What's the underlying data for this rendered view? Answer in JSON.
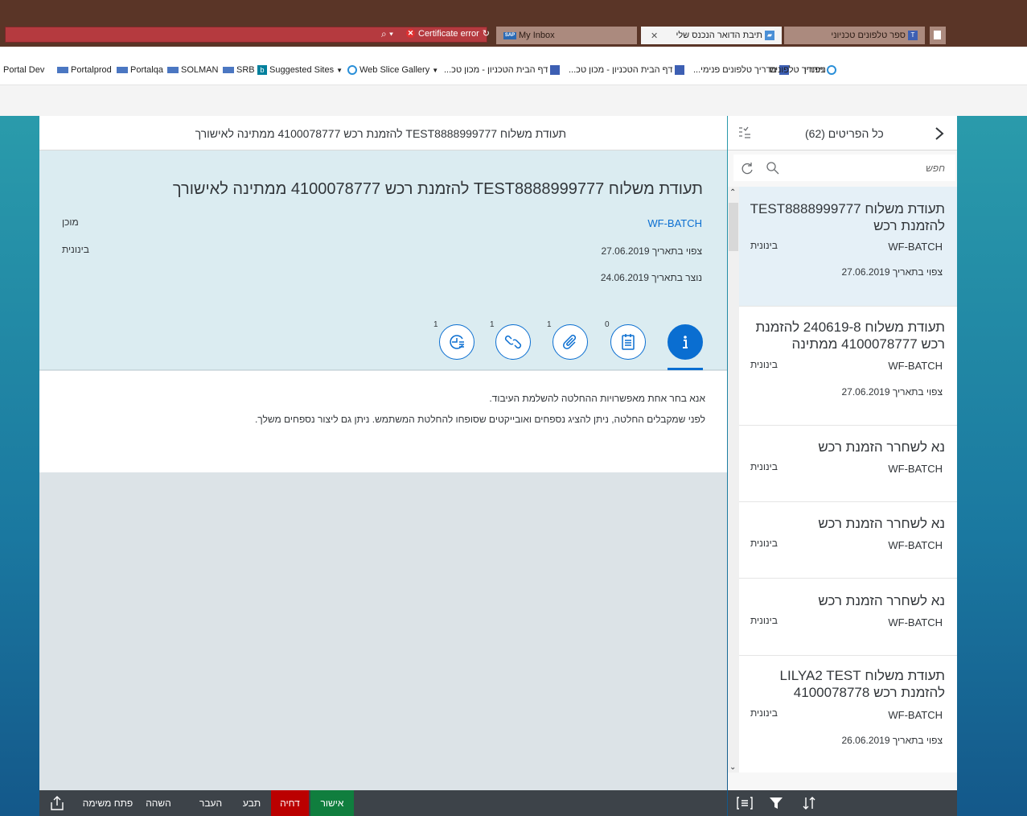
{
  "browser": {
    "tabs": [
      {
        "label": "ספר טלפונים טכניוני"
      },
      {
        "label": "תיבת הדואר הנכנס שלי"
      },
      {
        "label": "My Inbox"
      }
    ],
    "cert_error": "Certificate error",
    "favorites": [
      {
        "label": "Portal Dev"
      },
      {
        "label": "Portalprod"
      },
      {
        "label": "Portalqa"
      },
      {
        "label": "SOLMAN"
      },
      {
        "label": "SRB"
      },
      {
        "label": "Suggested Sites"
      },
      {
        "label": "Web Slice Gallery"
      },
      {
        "label": "דף הבית הטכניון - מכון טכ..."
      },
      {
        "label": "דף הבית הטכניון - מכון טכ..."
      },
      {
        "label": "מדריך טלפונים פנימי..."
      },
      {
        "label": "מדריך טלפונים"
      },
      {
        "label": "ניפנדו"
      }
    ]
  },
  "master": {
    "title": "כל הפריטים (62)",
    "search_placeholder": "חפש",
    "items": [
      {
        "title": "תעודת משלוח TEST8888999777 להזמנת רכש",
        "wf": "WF-BATCH",
        "priority": "בינונית",
        "due": "צפוי בתאריך 27.06.2019"
      },
      {
        "title": "תעודת משלוח 240619-8 להזמנת רכש 4100078777 ממתינה",
        "wf": "WF-BATCH",
        "priority": "בינונית",
        "due": "צפוי בתאריך 27.06.2019"
      },
      {
        "title": "נא לשחרר הזמנת רכש",
        "wf": "WF-BATCH",
        "priority": "בינונית",
        "due": ""
      },
      {
        "title": "נא לשחרר הזמנת רכש",
        "wf": "WF-BATCH",
        "priority": "בינונית",
        "due": ""
      },
      {
        "title": "נא לשחרר הזמנת רכש",
        "wf": "WF-BATCH",
        "priority": "בינונית",
        "due": ""
      },
      {
        "title": "תעודת משלוח LILYA2 TEST להזמנת רכש 4100078778",
        "wf": "WF-BATCH",
        "priority": "בינונית",
        "due": "צפוי בתאריך 26.06.2019"
      }
    ]
  },
  "detail": {
    "header_title": "תעודת משלוח TEST8888999777 להזמנת רכש 4100078777 ממתינה לאישורך",
    "title": "תעודת משלוח TEST8888999777 להזמנת רכש 4100078777 ממתינה לאישורך",
    "created_by": "WF-BATCH",
    "status": "מוכן",
    "priority": "בינונית",
    "due_date": "צפוי בתאריך 27.06.2019",
    "created_on": "נוצר בתאריך 24.06.2019",
    "tab_counts": {
      "notes": "0",
      "attachments": "1",
      "objects": "1",
      "history": "1"
    },
    "info_line1": "אנא בחר אחת מאפשרויות ההחלטה להשלמת העיבוד.",
    "info_line2": "לפני שמקבלים החלטה, ניתן להציג נספחים ואובייקטים שסופחו להחלטת המשתמש. ניתן גם ליצור נספחים משלך."
  },
  "footer": {
    "approve": "אישור",
    "reject": "דחיה",
    "claim": "תבע",
    "forward": "העבר",
    "suspend": "השהה",
    "open_task": "פתח משימה"
  },
  "colors": {
    "accent": "#0a6ed1",
    "approve": "#107e3e",
    "reject": "#bb0000",
    "footer": "#3d4349"
  }
}
